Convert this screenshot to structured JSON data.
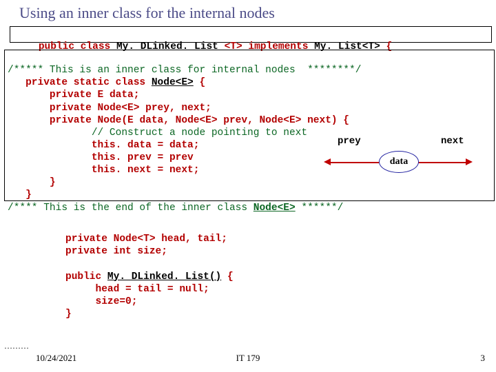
{
  "title": "Using an inner class for the internal nodes",
  "line1": {
    "kw1": "public class",
    "typ1": "My. DLinked. List",
    "mid": " <T> ",
    "kw2": "implements",
    "typ2": "My. List<T>",
    "end": " {"
  },
  "inner": {
    "c1a": "/***** This is an inner class for internal nodes  ",
    "c1b": "********/",
    "l2a": "   ",
    "l2kw": "private static class ",
    "l2typ": "Node<E>",
    "l2end": " {",
    "l3a": "       ",
    "l3kw": "private",
    "l3end": " E data;",
    "l4a": "       ",
    "l4kw": "private",
    "l4end": " Node<E> prey, next;",
    "l5a": "       ",
    "l5kw": "private",
    "l5end": " Node(E data, Node<E> prev, Node<E> next) {",
    "l6": "              // Construct a node pointing to next",
    "l7": "              this. data = data;",
    "l8": "              this. prev = prev",
    "l9": "              this. next = next;",
    "l10": "       }",
    "l11": "   }",
    "c12a": "/**** This is the end of the inner class ",
    "c12typ": "Node<E>",
    "c12b": " ******/"
  },
  "bottom": {
    "b1kw": "private",
    "b1": " Node<T> head, tail;",
    "b2kw": "private",
    "b2": " int size;",
    "blank": "",
    "b3kw": "public ",
    "b3typ": "My. DLinked. List()",
    "b3end": " {",
    "b4": "     head = tail = null;",
    "b5": "     size=0;",
    "b6": "}"
  },
  "diagram": {
    "prey": "prey",
    "next": "next",
    "data": "data"
  },
  "footer": {
    "ellipsis": "………",
    "date": "10/24/2021",
    "center": "IT 179",
    "page": "3"
  }
}
